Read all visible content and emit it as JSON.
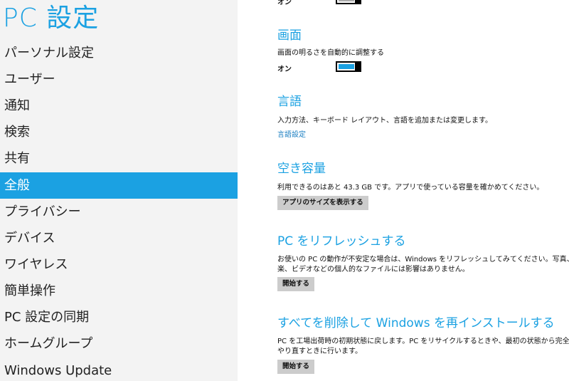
{
  "nav": {
    "title": "PC 設定",
    "items": [
      {
        "label": "パーソナル設定",
        "selected": false
      },
      {
        "label": "ユーザー",
        "selected": false
      },
      {
        "label": "通知",
        "selected": false
      },
      {
        "label": "検索",
        "selected": false
      },
      {
        "label": "共有",
        "selected": false
      },
      {
        "label": "全般",
        "selected": true
      },
      {
        "label": "プライバシー",
        "selected": false
      },
      {
        "label": "デバイス",
        "selected": false
      },
      {
        "label": "ワイヤレス",
        "selected": false
      },
      {
        "label": "簡単操作",
        "selected": false
      },
      {
        "label": "PC 設定の同期",
        "selected": false
      },
      {
        "label": "ホームグループ",
        "selected": false
      },
      {
        "label": "Windows Update",
        "selected": false
      }
    ]
  },
  "colors": {
    "accent": "#1ba1e2",
    "nav_bg": "#f3f3f3",
    "button_bg": "#cccccc"
  },
  "top": {
    "state": "オン"
  },
  "screen": {
    "heading": "画面",
    "description": "画面の明るさを自動的に調整する",
    "state": "オン"
  },
  "language": {
    "heading": "言語",
    "description": "入力方法、キーボード レイアウト、言語を追加または変更します。",
    "link": "言語設定"
  },
  "storage": {
    "heading": "空き容量",
    "description": "利用できるのはあと 43.3 GB です。アプリで使っている容量を確かめてください。",
    "button": "アプリのサイズを表示する"
  },
  "refresh": {
    "heading": "PC をリフレッシュする",
    "description_line1": "お使いの PC の動作が不安定な場合は、Windows をリフレッシュしてみてください。写真、音",
    "description_line2": "楽、ビデオなどの個人的なファイルには影響はありません。",
    "button": "開始する"
  },
  "reinstall": {
    "heading": "すべてを削除して Windows を再インストールする",
    "description_line1": "PC を工場出荷時の初期状態に戻します。PC をリサイクルするときや、最初の状態から完全に",
    "description_line2": "やり直すときに行います。",
    "button": "開始する"
  }
}
